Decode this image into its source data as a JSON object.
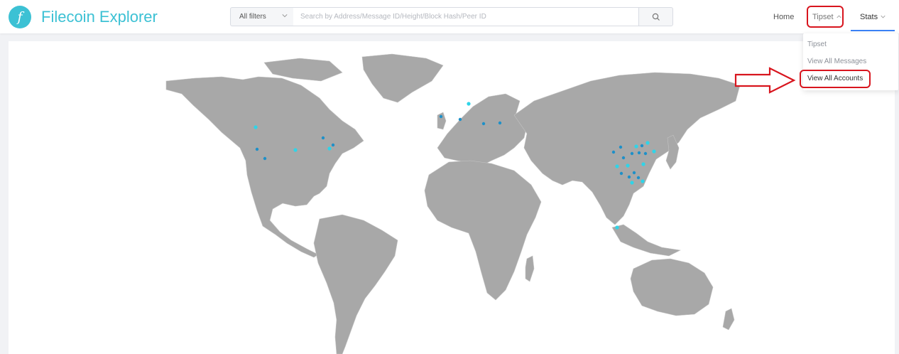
{
  "header": {
    "brand_title": "Filecoin Explorer",
    "logo_glyph": "f",
    "filter_select_value": "All filters",
    "search_placeholder": "Search by Address/Message ID/Height/Block Hash/Peer ID",
    "nav": {
      "home": "Home",
      "tipset": "Tipset",
      "stats": "Stats"
    }
  },
  "tipset_dropdown": {
    "items": [
      "Tipset",
      "View All Messages",
      "View All Accounts"
    ]
  },
  "colors": {
    "brand": "#3cc1d4",
    "map_land": "#a8a8a8",
    "node_marker": "#2fd4e8",
    "annotation": "#d8151e",
    "active_tab": "#3b82f6"
  },
  "icons": {
    "logo": "filecoin-logo-icon",
    "search": "search-icon",
    "chevron": "chevron-down-icon",
    "annotation_arrow": "arrow-right-icon"
  }
}
